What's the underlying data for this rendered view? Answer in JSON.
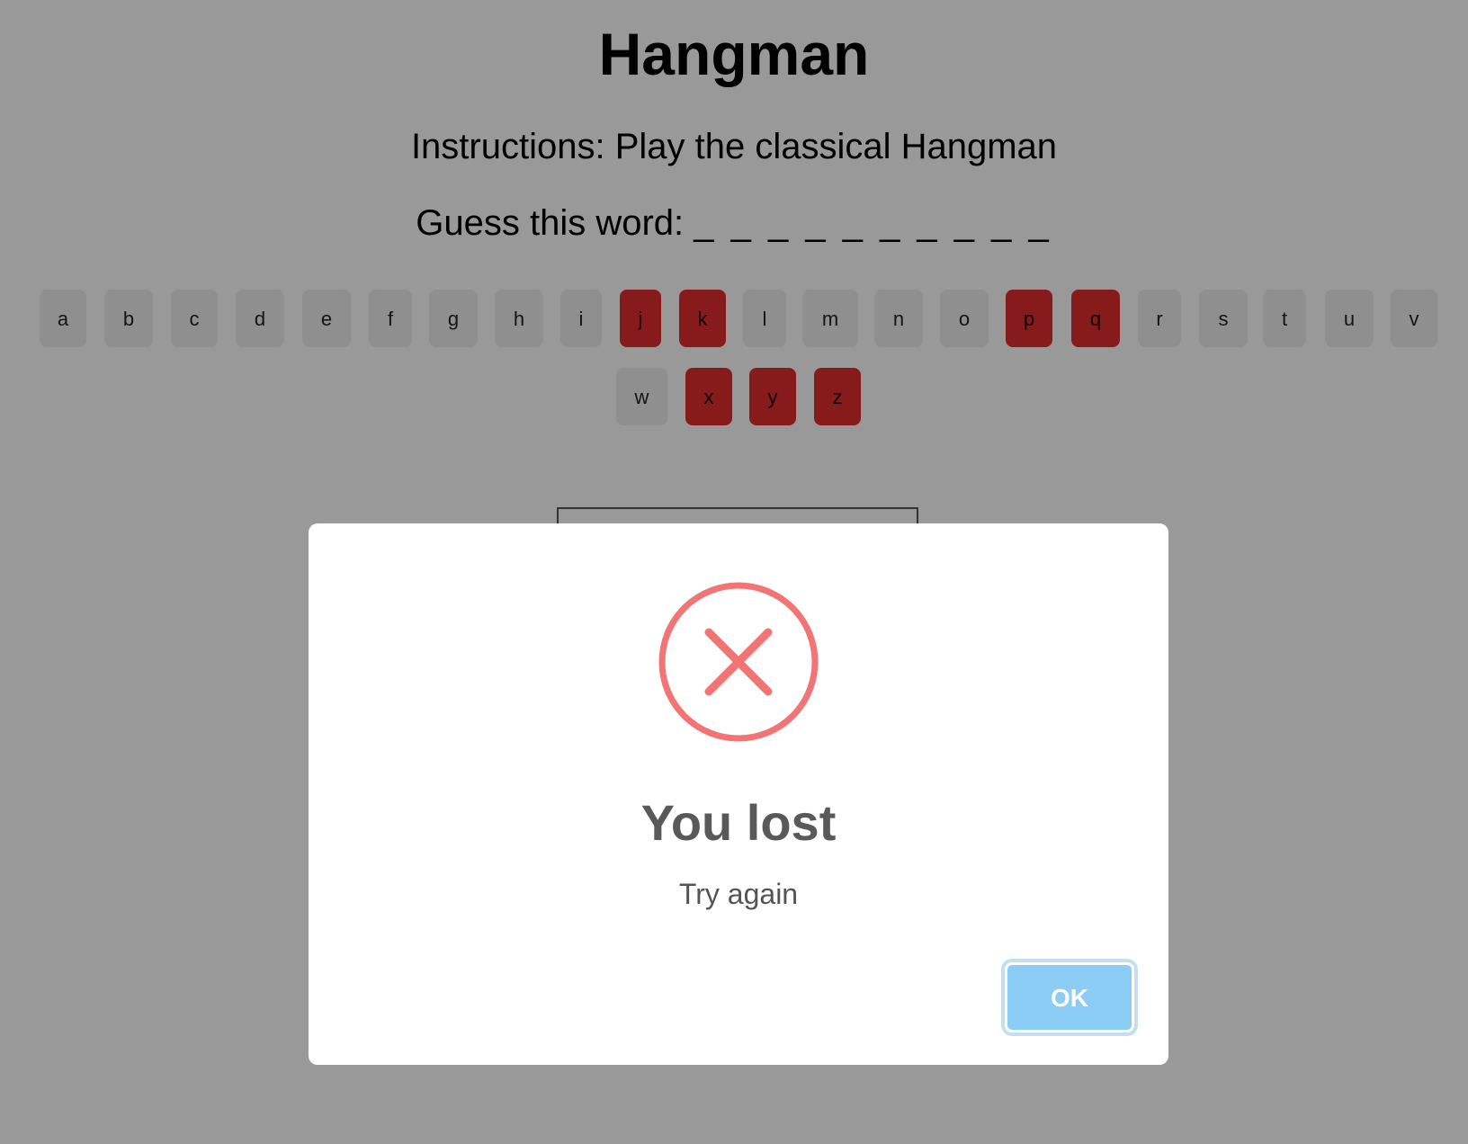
{
  "title": "Hangman",
  "instructions": "Instructions: Play the classical Hangman",
  "guess_label": "Guess this word:",
  "word_blanks": "_ _ _ _ _ _ _ _ _ _",
  "keyboard": {
    "keys": [
      "a",
      "b",
      "c",
      "d",
      "e",
      "f",
      "g",
      "h",
      "i",
      "j",
      "k",
      "l",
      "m",
      "n",
      "o",
      "p",
      "q",
      "r",
      "s",
      "t",
      "u",
      "v",
      "w",
      "x",
      "y",
      "z"
    ],
    "wrong_guesses": [
      "j",
      "k",
      "p",
      "q",
      "x",
      "y",
      "z"
    ]
  },
  "colors": {
    "wrong_key": "#e12c2c",
    "key": "#efefef",
    "error_icon": "#f27474",
    "ok_button": "#8ccdf5"
  },
  "dialog": {
    "icon": "error-x-icon",
    "title": "You lost",
    "text": "Try again",
    "ok_label": "OK"
  }
}
